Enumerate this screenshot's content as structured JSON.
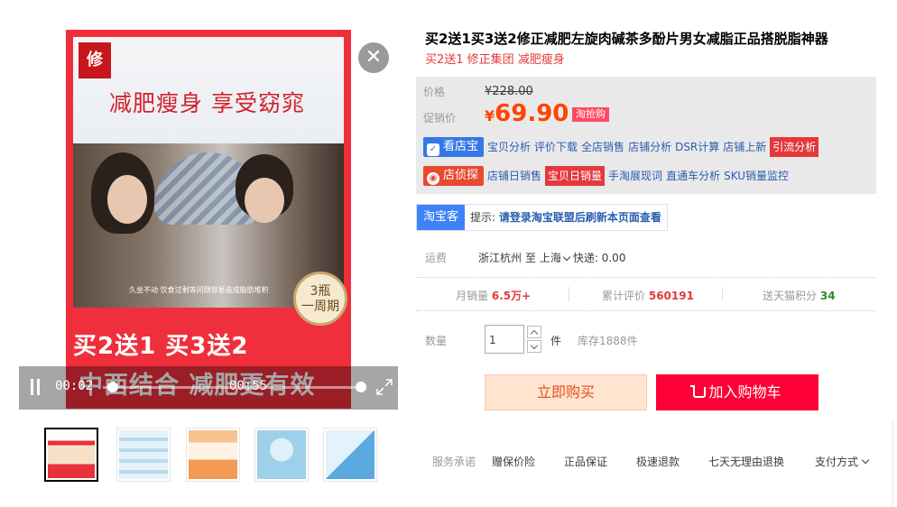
{
  "media": {
    "poster": {
      "slogan": "减肥瘦身 享受窈窕",
      "video_subtitle": "久坐不动 饮食过剩等问题容易造成脂肪堆积",
      "badge": [
        "3瓶",
        "一周期"
      ],
      "promo_line1": "买2送1 买3送2",
      "promo_line2": "中西结合 减肥更有效"
    },
    "video": {
      "current_time": "00:02",
      "duration": "00:55",
      "progress": 0.04
    },
    "close_glyph": "✕",
    "thumbnails": [
      "thumb-1",
      "thumb-2",
      "thumb-3",
      "thumb-4",
      "thumb-5"
    ]
  },
  "product": {
    "title": "买2送1买3送2修正减肥左旋肉碱茶多酚片男女减脂正品搭脱脂神器",
    "subtitle": "买2送1 修正集团 减肥瘦身"
  },
  "price": {
    "original_label": "价格",
    "original_value": "¥228.00",
    "promo_label": "促销价",
    "promo_symbol": "¥",
    "promo_value": "69.90",
    "promo_tag": "淘抢购"
  },
  "tools": {
    "row1_btn": "看店宝",
    "row1_links": [
      "宝贝分析",
      "评价下载",
      "全店销售",
      "店铺分析",
      "DSR计算",
      "店铺上新"
    ],
    "row1_highlight": "引流分析",
    "row2_btn": "店侦探",
    "row2_link1": "店铺日销售",
    "row2_highlight": "宝贝日销量",
    "row2_links": [
      "手淘展现词",
      "直通车分析",
      "SKU销量监控"
    ]
  },
  "taobaoke": {
    "tag": "淘宝客",
    "prefix": "提示:",
    "message": "请登录淘宝联盟后刷新本页面查看"
  },
  "shipping": {
    "label": "运费",
    "from": "浙江杭州",
    "to_word": "至",
    "to_city": "上海",
    "method": "快递: 0.00"
  },
  "stats": {
    "monthly_label": "月销量",
    "monthly_value": "6.5万+",
    "reviews_label": "累计评价",
    "reviews_value": "560191",
    "points_label": "送天猫积分",
    "points_value": "34"
  },
  "quantity": {
    "label": "数量",
    "value": "1",
    "unit": "件",
    "stock": "库存1888件"
  },
  "actions": {
    "buy_now": "立即购买",
    "add_to_cart": "加入购物车"
  },
  "service": {
    "label": "服务承诺",
    "items": [
      "赠保价险",
      "正品保证",
      "极速退款",
      "七天无理由退换"
    ],
    "payment": "支付方式"
  },
  "colors": {
    "price_red": "#ff4400",
    "tmall_red": "#ff0036",
    "taobaoke_blue": "#3e82f7",
    "kandianbao_blue": "#3478e5",
    "diantan_red": "#e8492f"
  }
}
